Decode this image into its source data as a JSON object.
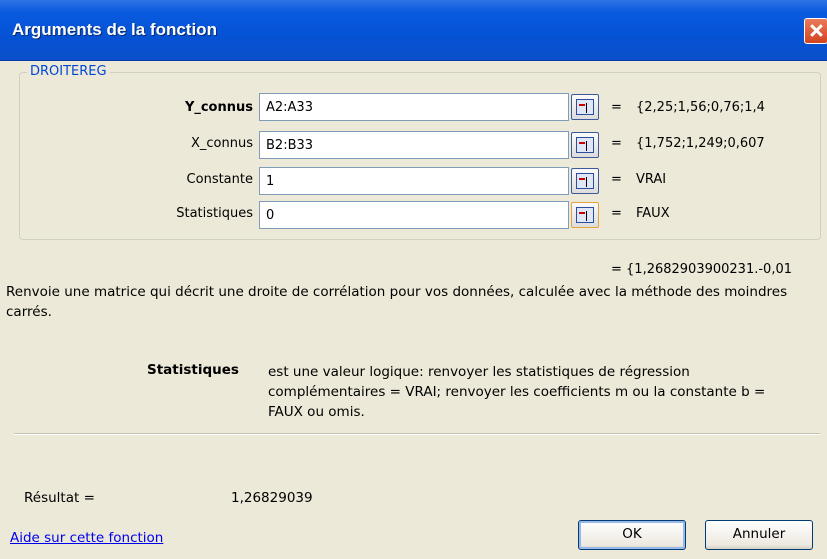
{
  "window": {
    "title": "Arguments de la fonction"
  },
  "function": {
    "name": "DROITEREG"
  },
  "arguments": [
    {
      "label": "Y_connus",
      "value": "A2:A33",
      "result": "{2,25;1,56;0,76;1,4"
    },
    {
      "label": "X_connus",
      "value": "B2:B33",
      "result": "{1,752;1,249;0,607"
    },
    {
      "label": "Constante",
      "value": "1",
      "result": "VRAI"
    },
    {
      "label": "Statistiques",
      "value": "0",
      "result": "FAUX"
    }
  ],
  "equals": "=",
  "formula_result": "= {1,2682903900231.-0,01",
  "description": "Renvoie une matrice qui décrit une droite de corrélation pour vos données, calculée avec la méthode des moindres carrés.",
  "argument_help": {
    "name": "Statistiques",
    "text": "est une valeur logique: renvoyer les statistiques de régression complémentaires = VRAI; renvoyer les coefficients m ou la constante b = FAUX ou omis."
  },
  "result": {
    "label": "Résultat =",
    "value": "1,26829039"
  },
  "help_link": "Aide sur cette fonction",
  "buttons": {
    "ok": "OK",
    "cancel": "Annuler"
  }
}
